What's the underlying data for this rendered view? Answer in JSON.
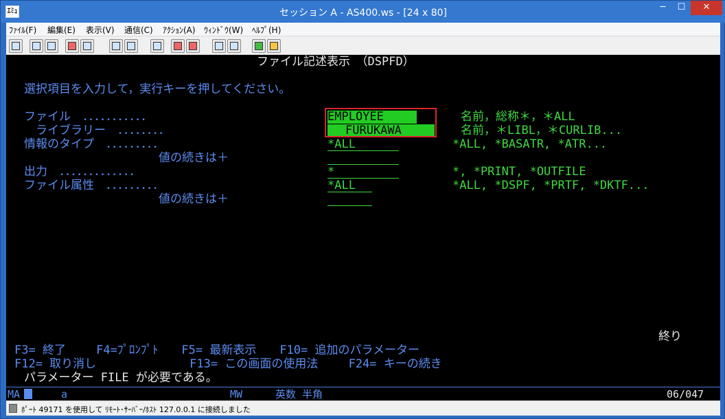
{
  "window": {
    "icon_text": "ｴﾐｭ",
    "title": "セッション A - AS400.ws - [24 x 80]",
    "min": "─",
    "max": "☐",
    "close": "✕"
  },
  "menu": [
    "ﾌｧｲﾙ(F)",
    "編集(E)",
    "表示(V)",
    "通信(C)",
    "ｱｸｼｮﾝ(A)",
    "ｳｨﾝﾄﾞｳ(W)",
    "ﾍﾙﾌﾟ(H)"
  ],
  "screen": {
    "title": "ファイル記述表示　（DSPFD）",
    "instruction": "選択項目を入力して，実行キーを押してください。",
    "rows": [
      {
        "label": "ファイル　．．．．．．．．．．．",
        "value": "EMPLOYEE",
        "hint": "名前，総称＊，＊ALL"
      },
      {
        "label": "　ライブラリー　．．．．．．．．",
        "value": "FURUKAWA",
        "hint": "名前，＊LIBL，＊CURLIB..."
      },
      {
        "label": "情報のタイプ　．．．．．．．．．",
        "value": "*ALL",
        "hint": "*ALL, *BASATR, *ATR..."
      },
      {
        "label": "値の続きは＋",
        "value": "",
        "hint": ""
      },
      {
        "label": "出力　．．．．．．．．．．．．．",
        "value": "*",
        "hint": "*, *PRINT, *OUTFILE"
      },
      {
        "label": "ファイル属性　．．．．．．．．．",
        "value": "*ALL",
        "hint": "*ALL, *DSPF, *PRTF, *DKTF..."
      },
      {
        "label": "値の続きは＋",
        "value": "",
        "hint": ""
      }
    ],
    "end_label": "終り",
    "fkeys_line1": "F3= 終了　　 F4=ﾌﾟﾛﾝﾌﾟﾄ　　F5= 最新表示　　F10= 追加のパラメーター",
    "fkeys_line2": "F12= 取り消し　　　　　　　　F13= この画面の使用法　　 F24= キーの続き",
    "message": "パラメーター FILE が必要である。"
  },
  "oia": {
    "ma": "MA",
    "a": "a",
    "mw": "MW",
    "mode": "英数 半角",
    "position": "06/047"
  },
  "status": {
    "text": "ﾎﾟｰﾄ 49171 を使用して ﾘﾓｰﾄ･ｻｰﾊﾞｰ/ﾎｽﾄ 127.0.0.1 に接続しました"
  },
  "colors": {
    "terminal_bg": "#000000",
    "field_green": "#40d840",
    "label_blue": "#5b8cf0",
    "title_bar": "#3478d0",
    "highlight_box": "#d8262b"
  }
}
